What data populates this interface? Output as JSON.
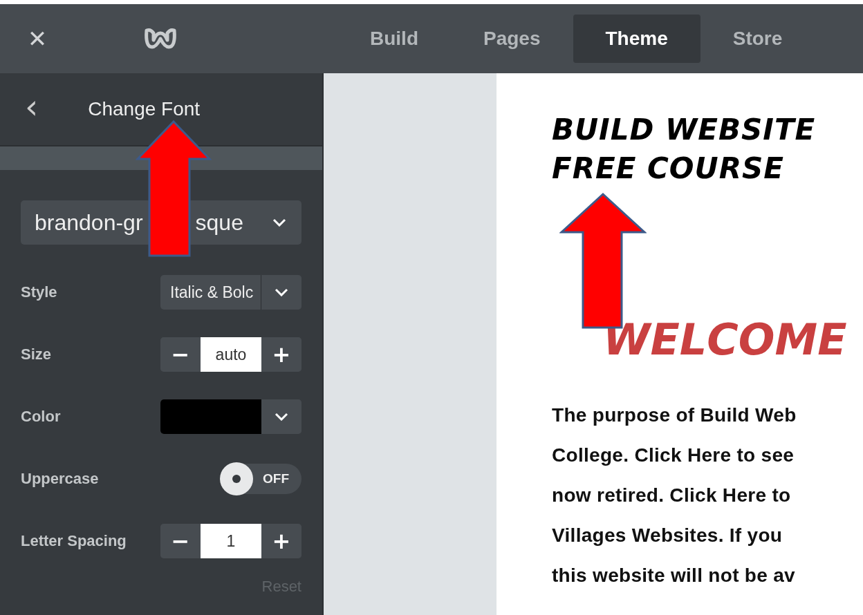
{
  "top_bar": {
    "close_icon": "✕",
    "tabs": [
      {
        "label": "Build",
        "selected": false
      },
      {
        "label": "Pages",
        "selected": false
      },
      {
        "label": "Theme",
        "selected": true
      },
      {
        "label": "Store",
        "selected": false
      }
    ]
  },
  "panel": {
    "back_icon": "‹",
    "title": "Change Font",
    "font_select": {
      "value_start": "brandon-gr",
      "value_end": "sque"
    },
    "settings": [
      {
        "kind": "select",
        "label": "Style",
        "value": "Italic & Bolc"
      },
      {
        "kind": "stepper",
        "label": "Size",
        "minus": "−",
        "value": "auto",
        "plus": "+"
      },
      {
        "kind": "color",
        "label": "Color",
        "color": "#000000"
      },
      {
        "kind": "toggle",
        "label": "Uppercase",
        "on": false,
        "state_text": "OFF"
      },
      {
        "kind": "stepper",
        "label": "Letter Spacing",
        "minus": "−",
        "value": "1",
        "plus": "+"
      }
    ],
    "reset": "Reset"
  },
  "page": {
    "title_lines": [
      "BUILD WEBSITE",
      "FREE COURSE"
    ],
    "welcome": "WELCOME",
    "paragraph_lines": [
      "The purpose of Build Web",
      "College. Click Here to see",
      "now retired.  Click Here to",
      "Villages Websites.  If you",
      "this website will not be av"
    ]
  }
}
